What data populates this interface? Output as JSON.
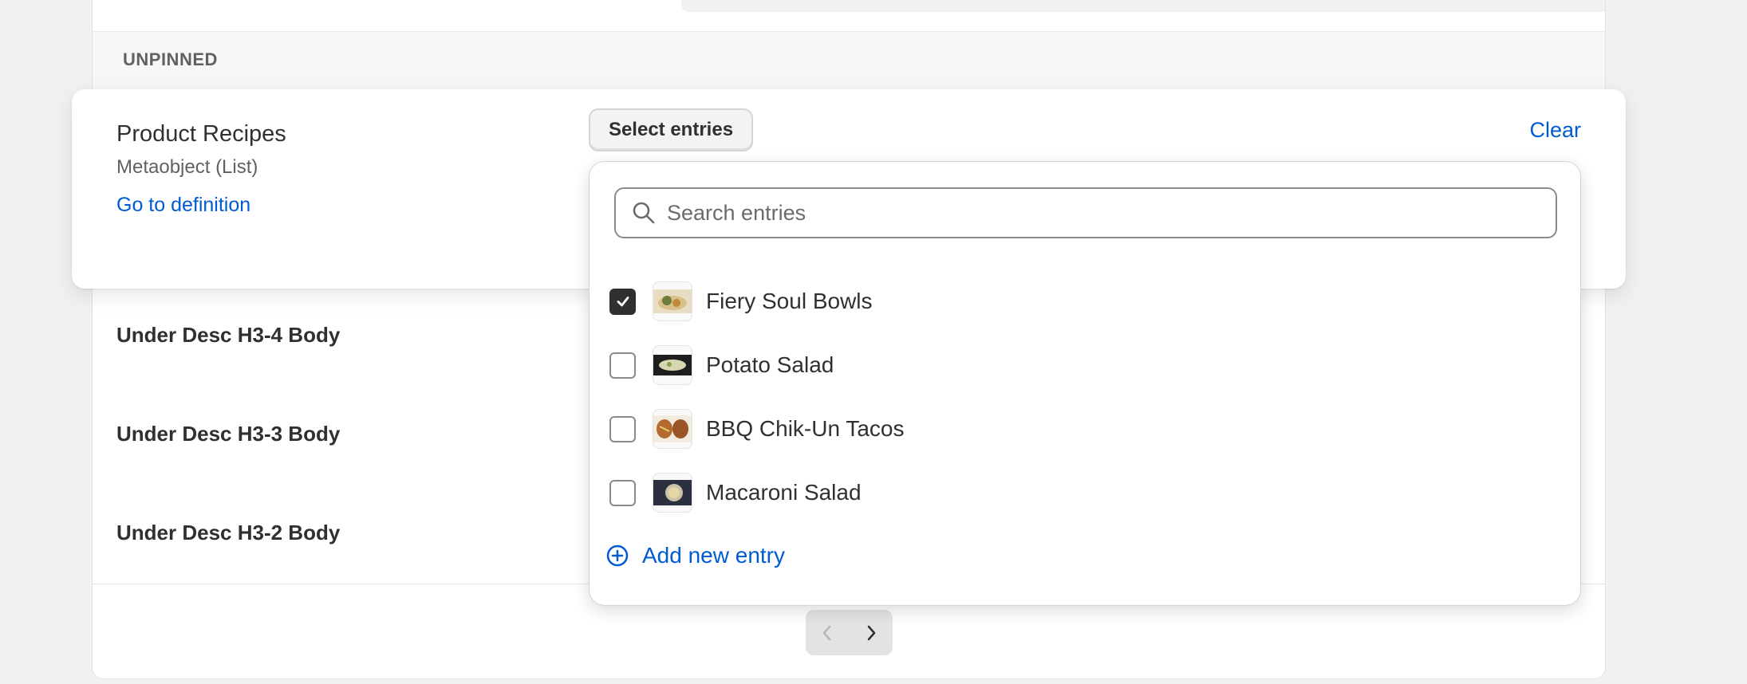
{
  "section": {
    "label": "UNPINNED"
  },
  "active_field": {
    "name": "Product Recipes",
    "type": "Metaobject (List)",
    "link": "Go to definition",
    "select_button": "Select entries",
    "clear": "Clear"
  },
  "rows": [
    {
      "label": "Under Desc H3-4 Body"
    },
    {
      "label": "Under Desc H3-3 Body"
    },
    {
      "label": "Under Desc H3-2 Body"
    }
  ],
  "popover": {
    "search_placeholder": "Search entries",
    "entries": [
      {
        "label": "Fiery Soul Bowls",
        "checked": true
      },
      {
        "label": "Potato Salad",
        "checked": false
      },
      {
        "label": "BBQ Chik-Un Tacos",
        "checked": false
      },
      {
        "label": "Macaroni Salad",
        "checked": false
      }
    ],
    "add_new": "Add new entry"
  },
  "colors": {
    "link": "#005bd3",
    "checkbox_checked": "#303030"
  },
  "icons": {
    "search": "search-icon",
    "check": "checkmark-icon",
    "add": "plus-circle-icon",
    "prev": "chevron-left-icon",
    "next": "chevron-right-icon"
  }
}
